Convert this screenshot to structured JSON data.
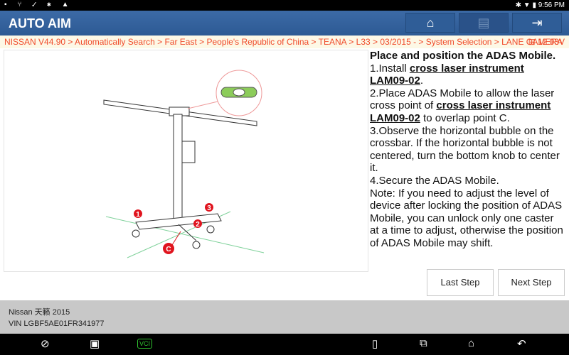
{
  "status_bar": {
    "left_icons": [
      "image-icon",
      "usb-icon",
      "check-icon",
      "bluetooth-icon",
      "warning-icon"
    ],
    "time": "9:56 PM"
  },
  "header": {
    "title": "AUTO AIM",
    "buttons": [
      {
        "name": "home"
      },
      {
        "name": "print"
      },
      {
        "name": "exit"
      }
    ]
  },
  "breadcrumb": {
    "path": "NISSAN V44.90 > Automatically Search > Far East > People's Republic of China > TEANA > L33 > 03/2015 - > System Selection > LANE CAMERA",
    "voltage": "12.03V"
  },
  "figure": {
    "labels": [
      "1",
      "2",
      "3",
      "C"
    ],
    "colors": {
      "marker": "#e0141e",
      "laser": "#7fd19a",
      "bubble": "#8ccc5a"
    }
  },
  "instructions": {
    "title": "Place and position the ADAS Mobile.",
    "s1a": "1.Install ",
    "s1link": "cross laser instrument LAM09-02",
    "s1b": ".",
    "s2a": "2.Place ADAS Mobile to allow the laser cross point of ",
    "s2link": "cross laser instrument LAM09-02",
    "s2b": " to overlap point C.",
    "s3": "3.Observe the horizontal bubble on the crossbar. If the horizontal bubble is not centered, turn the bottom knob to center it.",
    "s4": "4.Secure the ADAS Mobile.",
    "note": "Note: If you need to adjust the level of device after locking the position of ADAS Mobile, you can unlock only one caster at a time to adjust, otherwise the position of ADAS Mobile may shift."
  },
  "buttons": {
    "last": "Last Step",
    "next": "Next Step"
  },
  "footer": {
    "vehicle": "Nissan 天籁 2015",
    "vin": "VIN LGBF5AE01FR341977"
  },
  "nav_bar": {
    "icons": [
      "browser-icon",
      "gallery-icon",
      "vci-icon",
      "tablet-icon",
      "recents-icon",
      "home-icon",
      "back-icon"
    ],
    "vci_label": "VCI"
  }
}
